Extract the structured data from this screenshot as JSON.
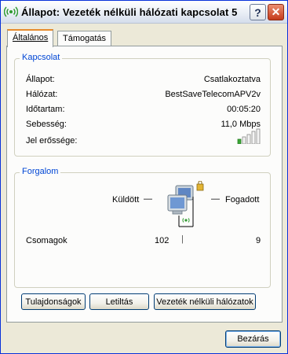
{
  "window": {
    "title": "Állapot: Vezeték nélküli hálózati kapcsolat 5",
    "help_symbol": "?",
    "close_symbol": "✕"
  },
  "tabs": [
    {
      "label": "Általános",
      "active": true
    },
    {
      "label": "Támogatás",
      "active": false
    }
  ],
  "connection": {
    "group_title": "Kapcsolat",
    "rows": [
      {
        "label": "Állapot:",
        "value": "Csatlakoztatva"
      },
      {
        "label": "Hálózat:",
        "value": "BestSaveTelecomAPV2v"
      },
      {
        "label": "Időtartam:",
        "value": "00:05:20"
      },
      {
        "label": "Sebesség:",
        "value": "11,0 Mbps"
      },
      {
        "label": "Jel erőssége:",
        "value": ""
      }
    ],
    "signal_bars_filled": 1,
    "signal_bars_total": 5
  },
  "traffic": {
    "group_title": "Forgalom",
    "sent_label": "Küldött",
    "received_label": "Fogadott",
    "packets_label": "Csomagok",
    "sent_packets": "102",
    "received_packets": "9"
  },
  "buttons": {
    "properties": "Tulajdonságok",
    "disable": "Letiltás",
    "wireless_networks": "Vezeték nélküli hálózatok",
    "close": "Bezárás"
  },
  "colors": {
    "title_gradient_top": "#ffffff",
    "group_title": "#0046d5",
    "close_button": "#c43a1b",
    "signal_on": "#3aa535",
    "active_tab_accent": "#e68b2c"
  }
}
